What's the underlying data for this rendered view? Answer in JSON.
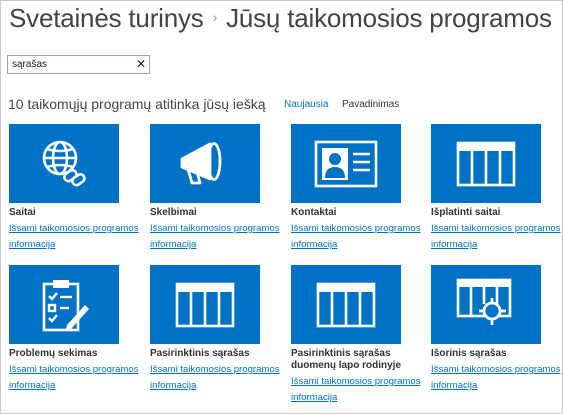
{
  "breadcrumb": {
    "site_contents": "Svetainės turinys",
    "separator": "›",
    "current": "Jūsų taikomosios programos"
  },
  "search": {
    "value": "sąrašas",
    "clear_glyph": "✕"
  },
  "results": {
    "count_text": "10 taikomųjų programų atitinka jūsų iešką",
    "sort_newest": "Naujausia",
    "sort_name": "Pavadinimas"
  },
  "apps": [
    {
      "name": "Saitai",
      "icon": "link-globe-icon",
      "details": "Išsami taikomosios programos informacija"
    },
    {
      "name": "Skelbimai",
      "icon": "megaphone-icon",
      "details": "Išsami taikomosios programos informacija"
    },
    {
      "name": "Kontaktai",
      "icon": "contact-card-icon",
      "details": "Išsami taikomosios programos informacija"
    },
    {
      "name": "Išplatinti saitai",
      "icon": "list-grid-icon",
      "details": "Išsami taikomosios programos informacija"
    },
    {
      "name": "Problemų sekimas",
      "icon": "clipboard-checklist-icon",
      "details": "Išsami taikomosios programos informacija"
    },
    {
      "name": "Pasirinktinis sąrašas",
      "icon": "list-grid-icon",
      "details": "Išsami taikomosios programos informacija"
    },
    {
      "name": "Pasirinktinis sąrašas duomenų lapo rodinyje",
      "icon": "list-grid-icon",
      "details": "Išsami taikomosios programos informacija"
    },
    {
      "name": "Išorinis sąrašas",
      "icon": "external-list-icon",
      "details": "Išsami taikomosios programos informacija"
    }
  ],
  "colors": {
    "accent": "#0072c6",
    "tile_icon_bg": "#0072c6"
  }
}
